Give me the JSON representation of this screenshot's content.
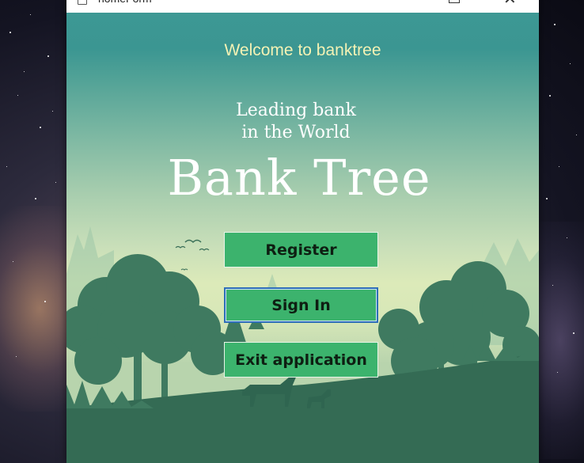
{
  "window": {
    "title": "homeForm",
    "controls": {
      "maximize_icon": "maximize-icon",
      "close_icon": "close-icon",
      "close_glyph": "✕"
    }
  },
  "content": {
    "welcome_text": "Welcome to banktree",
    "tagline_line1": "Leading bank",
    "tagline_line2": "in the World",
    "brand_name": "Bank Tree"
  },
  "buttons": {
    "register_label": "Register",
    "sign_in_label": "Sign In",
    "exit_label": "Exit application"
  },
  "colors": {
    "button_bg": "#3cb36d",
    "welcome_text": "#f4f2b4",
    "forest": "#3a7a62",
    "sky_top": "#3d9894"
  }
}
